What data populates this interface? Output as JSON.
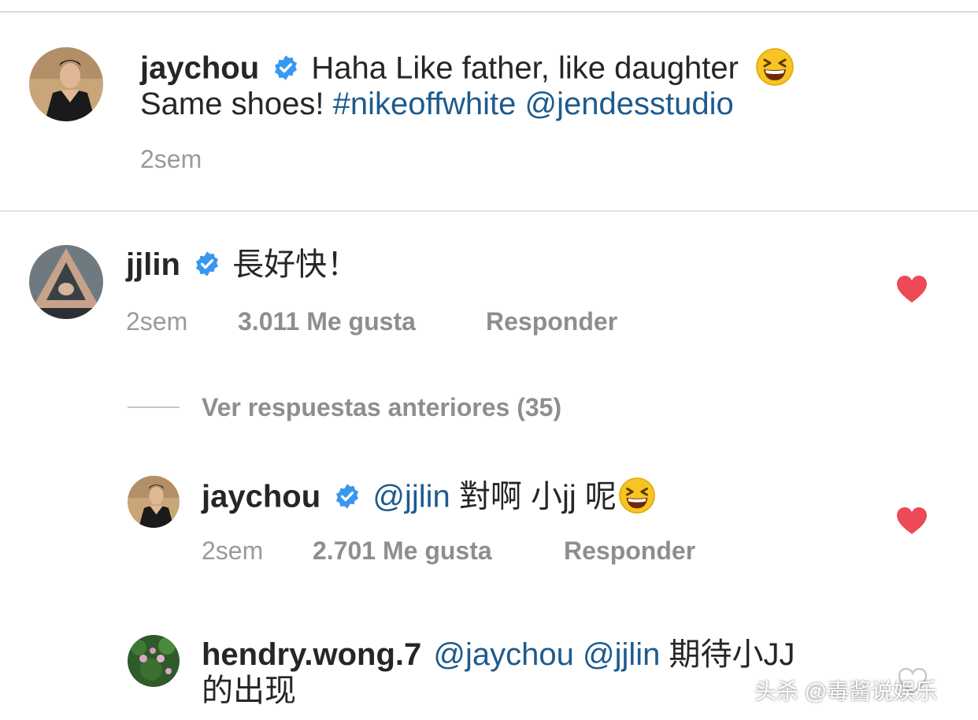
{
  "post": {
    "author": "jaychou",
    "caption_text": "Haha Like father, like daughter",
    "caption_line2": "Same shoes!",
    "hashtag": "#nikeoffwhite",
    "mention": "@jendesstudio",
    "time": "2sem"
  },
  "comments": [
    {
      "author": "jjlin",
      "text": "長好快！",
      "time": "2sem",
      "likes": "3.011 Me gusta",
      "reply_label": "Responder"
    }
  ],
  "replies_toggle": "Ver respuestas anteriores (35)",
  "replies": [
    {
      "author": "jaychou",
      "mention": "@jjlin",
      "text": "對啊 小jj 呢",
      "time": "2sem",
      "likes": "2.701 Me gusta",
      "reply_label": "Responder"
    },
    {
      "author": "hendry.wong.7",
      "mention1": "@jaychou",
      "mention2": "@jjlin",
      "text_part1": "期待小JJ",
      "text_part2": "的出现"
    }
  ],
  "watermark": "头杀 @毒酱说娱乐",
  "colors": {
    "link": "#1d5b8f",
    "verified": "#3897f0",
    "heart": "#ed4956",
    "meta": "#8e8e8e"
  },
  "icons": [
    "verified-badge-icon",
    "laughing-emoji-icon",
    "heart-icon"
  ]
}
